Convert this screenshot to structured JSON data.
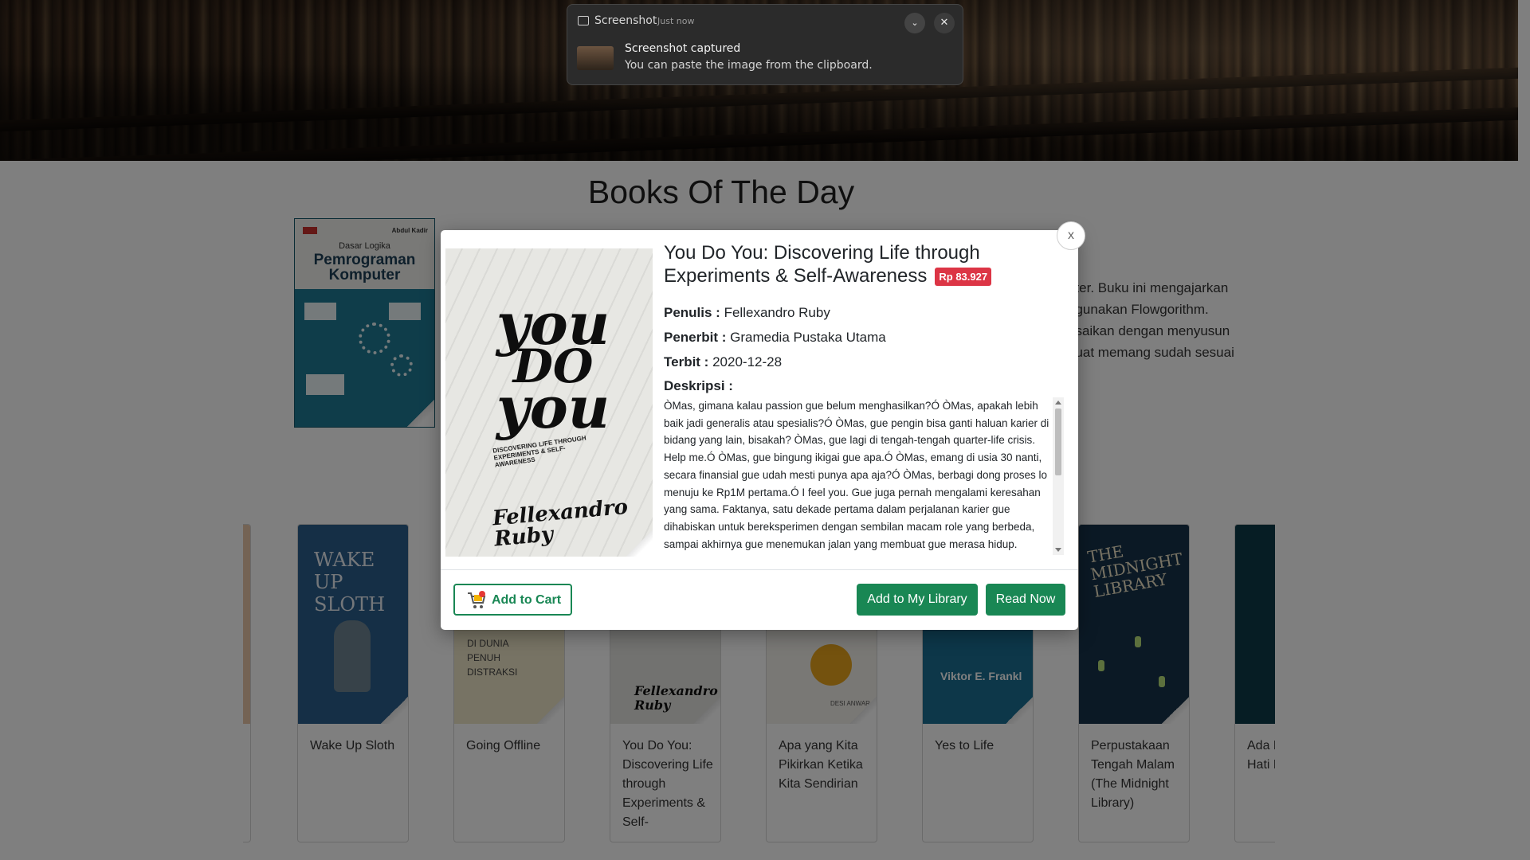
{
  "section": {
    "title": "Books Of The Day"
  },
  "book_of_day": {
    "cover": {
      "author": "Abdul Kadir",
      "line1": "Dasar Logika",
      "line2": "Pemrograman",
      "line3": "Komputer"
    },
    "desc_lines": [
      "uter. Buku ini mengajarkan",
      "ggunakan Flowgorithm.",
      "esaikan dengan menyusun",
      " buat memang sudah sesuai"
    ]
  },
  "carousel": {
    "cards": [
      {
        "title": "Wake Up Sloth",
        "cover_text": "WAKE UP SLOTH",
        "cover_color": "#2b5f8c"
      },
      {
        "title": "Going Offline",
        "cover_text": "DI DUNIA PENUH DISTRAKSI",
        "cover_color": "#efe6c8"
      },
      {
        "title": "You Do You: Discovering Life through Experiments & Self-",
        "cover_text": "Fellexandro Ruby",
        "cover_color": "#e4e4e0"
      },
      {
        "title": "Apa yang Kita Pikirkan Ketika Kita Sendirian",
        "cover_text": "DESI ANWAR",
        "cover_color": "#f3f1ea"
      },
      {
        "title": "Yes to Life",
        "cover_text": "Viktor E. Frankl",
        "cover_color": "#2d8bb6"
      },
      {
        "title": "Perpustakaan Tengah Malam (The Midnight Library)",
        "cover_text": "THE MIDNIGHT LIBRARY",
        "cover_color": "#17324a"
      },
      {
        "title": "Ada Hal yang Hati Bisa",
        "cover_text": "",
        "cover_color": "#0d3b48"
      }
    ]
  },
  "modal": {
    "close_label": "x",
    "title": "You Do You: Discovering Life through Experiments & Self-Awareness",
    "price": "Rp 83.927",
    "author_label": "Penulis :",
    "author": "Fellexandro Ruby",
    "publisher_label": "Penerbit :",
    "publisher": "Gramedia Pustaka Utama",
    "published_label": "Terbit :",
    "published": "2020-12-28",
    "description_label": "Deskripsi :",
    "description": "ÒMas, gimana kalau passion gue belum menghasilkan?Ó ÒMas, apakah lebih baik jadi generalis atau spesialis?Ó ÒMas, gue pengin bisa ganti haluan karier di bidang yang lain, bisakah? ÒMas, gue lagi di tengah-tengah quarter-life crisis. Help me.Ó ÒMas, gue bingung ikigai gue apa.Ó ÒMas, emang di usia 30 nanti, secara finansial gue udah mesti punya apa aja?Ó ÒMas, berbagi dong proses lo menuju ke Rp1M pertama.Ó I feel you. Gue juga pernah mengalami keresahan yang sama. Faktanya, satu dekade pertama dalam perjalanan karier gue dihabiskan untuk bereksperimen dengan sembilan macam role yang berbeda, sampai akhirnya gue menemukan jalan yang membuat gue merasa hidup.",
    "cover": {
      "w1": "you",
      "w2": "DO",
      "w3": "you",
      "sub": "DISCOVERING LIFE THROUGH EXPERIMENTS & SELF-AWARENESS",
      "author": "Fellexandro Ruby"
    },
    "buttons": {
      "cart": "Add to Cart",
      "library": "Add to My Library",
      "read": "Read Now"
    }
  },
  "notification": {
    "app": "Screenshot",
    "time": "Just now",
    "title": "Screenshot captured",
    "body": "You can paste the image from the clipboard."
  }
}
